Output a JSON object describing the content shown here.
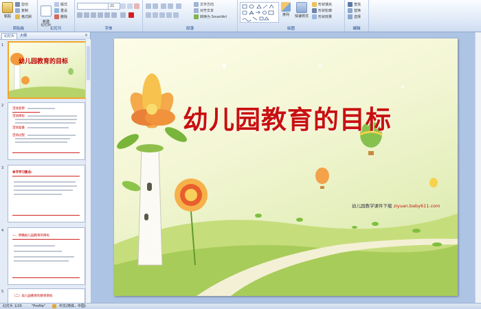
{
  "ribbon": {
    "clipboard": {
      "label": "剪贴板",
      "paste": "粘贴",
      "cut": "剪切",
      "copy": "复制",
      "painter": "格式刷"
    },
    "slides": {
      "label": "幻灯片",
      "new_slide": "新建\n幻灯片",
      "layout": "版式",
      "reset": "重设",
      "delete": "删除"
    },
    "font": {
      "label": "字体",
      "font_name": "",
      "font_size": "21"
    },
    "paragraph": {
      "label": "段落",
      "text_direction": "文字方向",
      "align_text": "对齐文本",
      "smartart": "转换为 SmartArt"
    },
    "drawing": {
      "label": "绘图",
      "arrange": "排列",
      "quick_styles": "快速样式",
      "fill": "形状填充",
      "outline": "形状轮廓",
      "effects": "形状效果"
    },
    "editing": {
      "label": "编辑",
      "find": "查找",
      "replace": "替换",
      "select": "选择"
    }
  },
  "panel": {
    "tab_slides": "幻灯片",
    "tab_outline": "大纲",
    "close": "×",
    "thumbs": [
      {
        "num": "1",
        "title": "幼儿园教育的目标"
      },
      {
        "num": "2",
        "lines": [
          "活动名称",
          "活动目标",
          "活动准备",
          "活动过程"
        ]
      },
      {
        "num": "3",
        "heading": "本节学习要点:"
      },
      {
        "num": "4",
        "heading": "一、明确幼儿园教育的目标"
      },
      {
        "num": "5",
        "heading": "（二）幼儿园教育的教育目标"
      }
    ]
  },
  "slide": {
    "title": "幼儿园教育的目标",
    "credit_prefix": "幼儿园教学课件下载",
    "credit_url": "ziyuan.baby611.com"
  },
  "status": {
    "slide_info": "幻灯片 1/20",
    "theme": "\"Profile\"",
    "language": "中文(简体，中国)"
  },
  "colors": {
    "title_red": "#c81010",
    "ribbon_blue": "#15428b",
    "selection_orange": "#f2a52a"
  }
}
